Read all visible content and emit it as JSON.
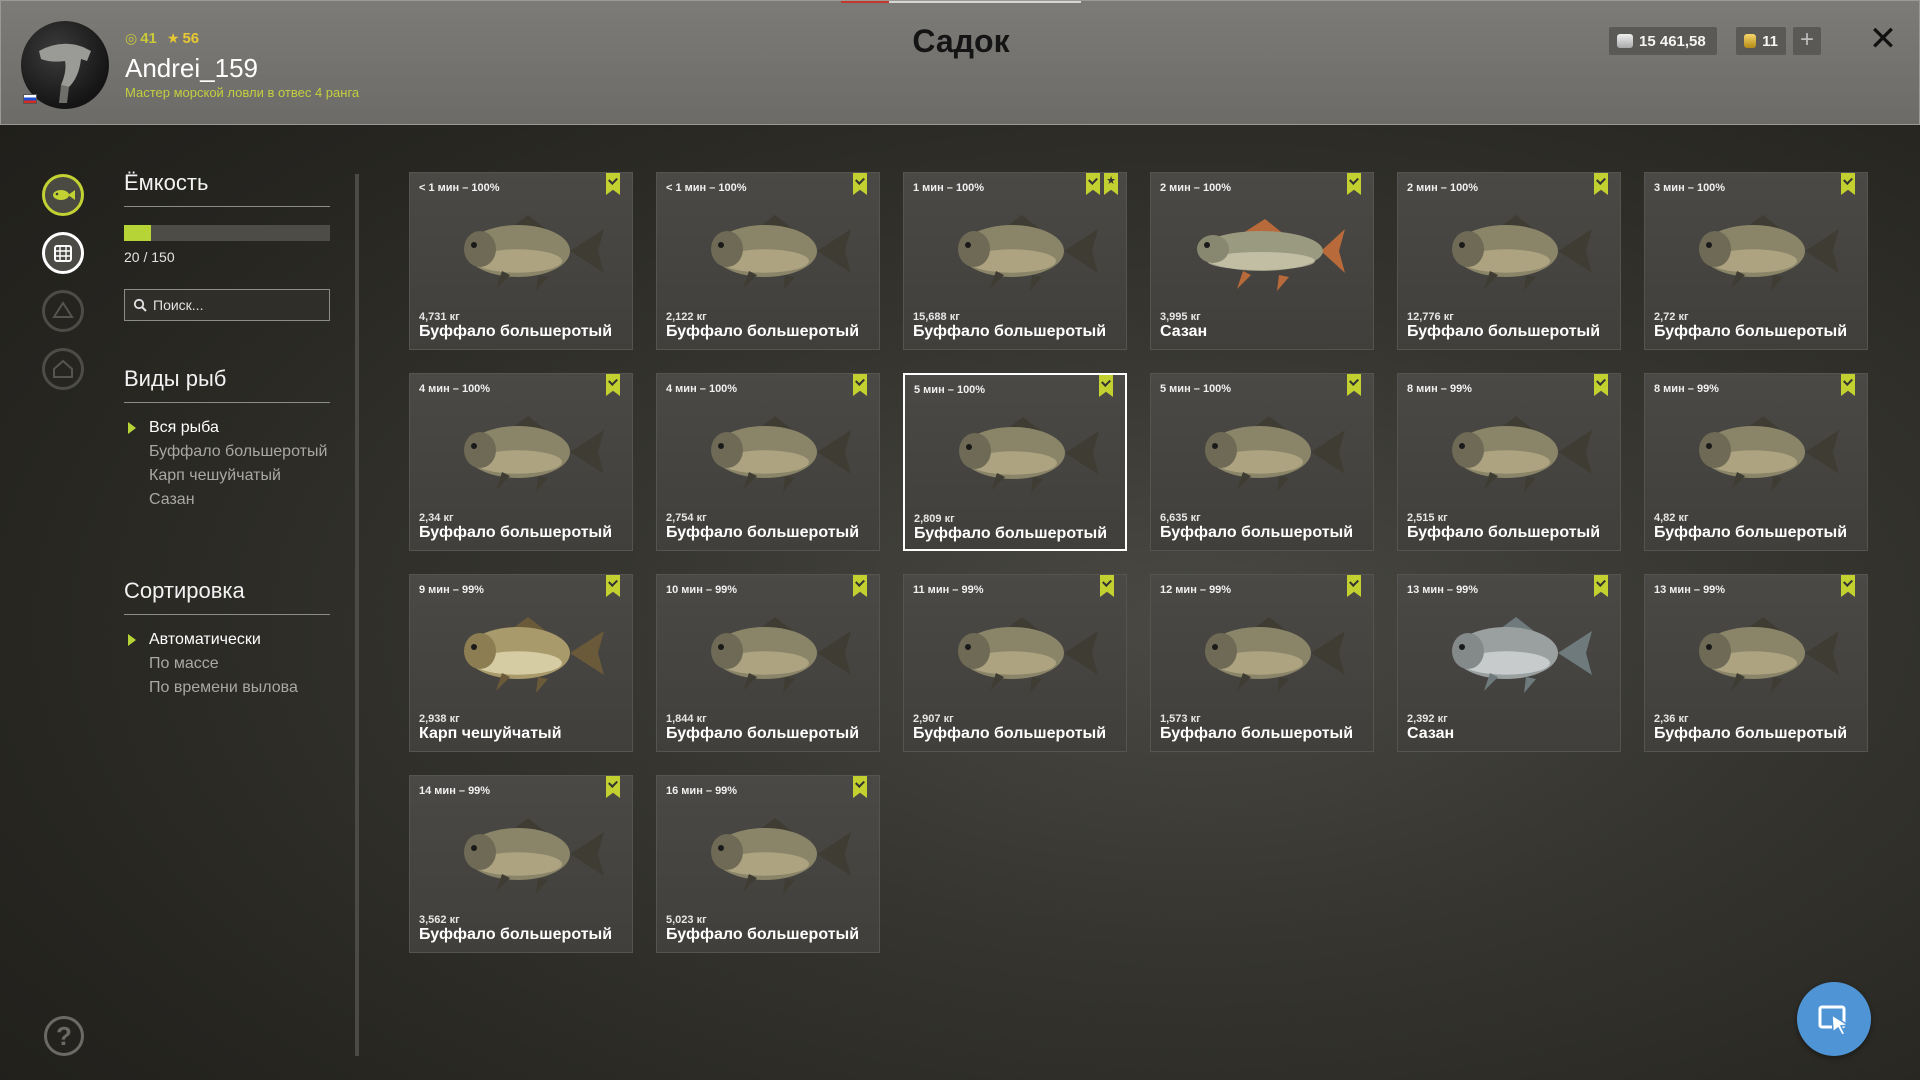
{
  "header": {
    "title": "Садок",
    "username": "Andrei_159",
    "rank": "Мастер морской ловли в отвес 4 ранга",
    "level": "41",
    "stars": "56",
    "silver": "15 461,58",
    "gold": "11",
    "plus_label": "+",
    "close_label": "✕"
  },
  "capacity": {
    "title": "Ёмкость",
    "count": "20 / 150",
    "fraction": 0.133
  },
  "search": {
    "placeholder": "Поиск..."
  },
  "species": {
    "title": "Виды рыб",
    "options": [
      "Вся рыба",
      "Буффало большеротый",
      "Карп чешуйчатый",
      "Сазан"
    ]
  },
  "sorting": {
    "title": "Сортировка",
    "options": [
      "Автоматически",
      "По массе",
      "По времени вылова"
    ]
  },
  "help": {
    "label": "?"
  },
  "fish": [
    {
      "time": "< 1 мин – 100%",
      "weight": "4,731 кг",
      "name": "Буффало большеротый",
      "kind": "buffalo",
      "fav": false
    },
    {
      "time": "< 1 мин – 100%",
      "weight": "2,122 кг",
      "name": "Буффало большеротый",
      "kind": "buffalo",
      "fav": false
    },
    {
      "time": "1 мин – 100%",
      "weight": "15,688 кг",
      "name": "Буффало большеротый",
      "kind": "buffalo",
      "fav": true
    },
    {
      "time": "2 мин – 100%",
      "weight": "3,995 кг",
      "name": "Сазан",
      "kind": "sazan",
      "fav": false
    },
    {
      "time": "2 мин – 100%",
      "weight": "12,776 кг",
      "name": "Буффало большеротый",
      "kind": "buffalo",
      "fav": false
    },
    {
      "time": "3 мин – 100%",
      "weight": "2,72 кг",
      "name": "Буффало большеротый",
      "kind": "buffalo",
      "fav": false
    },
    {
      "time": "4 мин – 100%",
      "weight": "2,34 кг",
      "name": "Буффало большеротый",
      "kind": "buffalo",
      "fav": false
    },
    {
      "time": "4 мин – 100%",
      "weight": "2,754 кг",
      "name": "Буффало большеротый",
      "kind": "buffalo",
      "fav": false
    },
    {
      "time": "5 мин – 100%",
      "weight": "2,809 кг",
      "name": "Буффало большеротый",
      "kind": "buffalo",
      "fav": false
    },
    {
      "time": "5 мин – 100%",
      "weight": "6,635 кг",
      "name": "Буффало большеротый",
      "kind": "buffalo",
      "fav": false
    },
    {
      "time": "8 мин – 99%",
      "weight": "2,515 кг",
      "name": "Буффало большеротый",
      "kind": "buffalo",
      "fav": false
    },
    {
      "time": "8 мин – 99%",
      "weight": "4,82 кг",
      "name": "Буффало большеротый",
      "kind": "buffalo",
      "fav": false
    },
    {
      "time": "9 мин – 99%",
      "weight": "2,938 кг",
      "name": "Карп чешуйчатый",
      "kind": "carp",
      "fav": false
    },
    {
      "time": "10 мин – 99%",
      "weight": "1,844 кг",
      "name": "Буффало большеротый",
      "kind": "buffalo",
      "fav": false
    },
    {
      "time": "11 мин – 99%",
      "weight": "2,907 кг",
      "name": "Буффало большеротый",
      "kind": "buffalo",
      "fav": false
    },
    {
      "time": "12 мин – 99%",
      "weight": "1,573 кг",
      "name": "Буффало большеротый",
      "kind": "buffalo",
      "fav": false
    },
    {
      "time": "13 мин – 99%",
      "weight": "2,392 кг",
      "name": "Сазан",
      "kind": "silver",
      "fav": false
    },
    {
      "time": "13 мин – 99%",
      "weight": "2,36 кг",
      "name": "Буффало большеротый",
      "kind": "buffalo",
      "fav": false
    },
    {
      "time": "14 мин – 99%",
      "weight": "3,562 кг",
      "name": "Буффало большеротый",
      "kind": "buffalo",
      "fav": false
    },
    {
      "time": "16 мин – 99%",
      "weight": "5,023 кг",
      "name": "Буффало большеротый",
      "kind": "buffalo",
      "fav": false
    }
  ],
  "selected_index": 8,
  "colors": {
    "accent": "#c2d12f",
    "fab": "#4f95d6"
  },
  "icons": {
    "rail": [
      "fish-icon",
      "keepnet-icon",
      "boat-icon",
      "home-icon"
    ],
    "bookmark": "bookmark-check-icon",
    "favorite": "star-bookmark-icon",
    "fab": "cursor-icon"
  }
}
